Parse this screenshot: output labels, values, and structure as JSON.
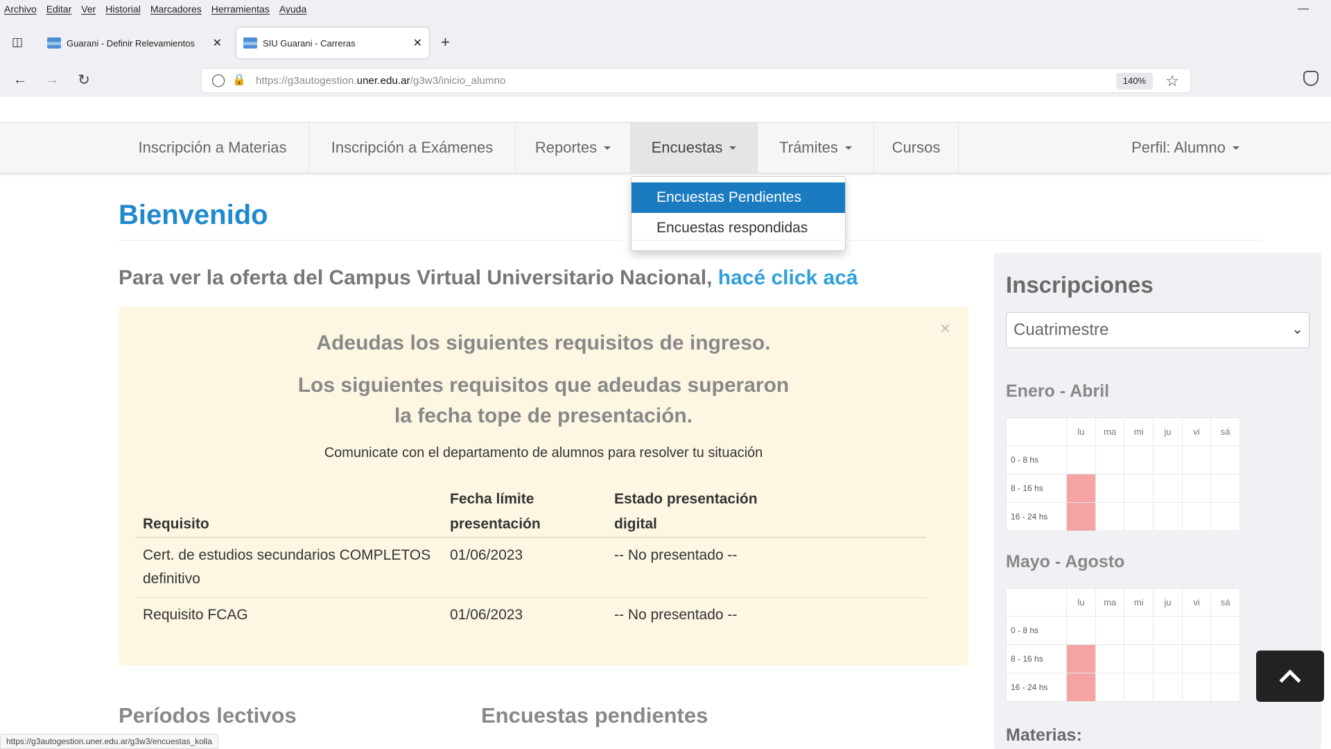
{
  "browser": {
    "menu": [
      "Archivo",
      "Editar",
      "Ver",
      "Historial",
      "Marcadores",
      "Herramientas",
      "Ayuda"
    ],
    "tabs": [
      {
        "title": "Guarani - Definir Relevamientos",
        "active": false
      },
      {
        "title": "SIU Guarani - Carreras",
        "active": true
      }
    ],
    "url_prefix": "https://g3autogestion.",
    "url_domain": "uner.edu.ar",
    "url_path": "/g3w3/inicio_alumno",
    "zoom": "140%",
    "status_url": "https://g3autogestion.uner.edu.ar/g3w3/encuestas_kolla"
  },
  "nav": {
    "items": [
      {
        "label": "Inscripción a Materias",
        "caret": false
      },
      {
        "label": "Inscripción a Exámenes",
        "caret": false
      },
      {
        "label": "Reportes",
        "caret": true
      },
      {
        "label": "Encuestas",
        "caret": true,
        "active": true
      },
      {
        "label": "Trámites",
        "caret": true
      },
      {
        "label": "Cursos",
        "caret": false
      }
    ],
    "profile": "Perfil: Alumno",
    "dropdown": [
      "Encuestas Pendientes",
      "Encuestas respondidas"
    ]
  },
  "main": {
    "title": "Bienvenido",
    "campus_text": "Para ver la oferta del Campus Virtual Universitario Nacional, ",
    "campus_link": "hacé click acá"
  },
  "alert": {
    "close": "×",
    "heading1": "Adeudas los siguientes requisitos de ingreso.",
    "heading2": "Los siguientes requisitos que adeudas superaron la fecha tope de presentación.",
    "note": "Comunicate con el departamento de alumnos para resolver tu situación",
    "columns": [
      "Requisito",
      "Fecha límite presentación",
      "Estado presentación digital"
    ],
    "rows": [
      {
        "req": "Cert. de estudios secundarios COMPLETOS definitivo",
        "fecha": "01/06/2023",
        "estado": "-- No presentado --"
      },
      {
        "req": "Requisito FCAG",
        "fecha": "01/06/2023",
        "estado": "-- No presentado --"
      }
    ]
  },
  "inscripciones": {
    "title": "Inscripciones",
    "select_value": "Cuatrimestre",
    "days": [
      "lu",
      "ma",
      "mi",
      "ju",
      "vi",
      "sá"
    ],
    "slots": [
      "0 - 8 hs",
      "8 - 16 hs",
      "16 - 24 hs"
    ],
    "periods": [
      {
        "name": "Enero - Abril",
        "active": [
          [
            false,
            false,
            false,
            false,
            false,
            false
          ],
          [
            true,
            false,
            false,
            false,
            false,
            false
          ],
          [
            true,
            false,
            false,
            false,
            false,
            false
          ]
        ]
      },
      {
        "name": "Mayo - Agosto",
        "active": [
          [
            false,
            false,
            false,
            false,
            false,
            false
          ],
          [
            true,
            false,
            false,
            false,
            false,
            false
          ],
          [
            true,
            false,
            false,
            false,
            false,
            false
          ]
        ]
      }
    ],
    "materias": "Materias:"
  },
  "bottom": {
    "periodos": "Períodos lectivos",
    "encuestas": "Encuestas pendientes"
  }
}
